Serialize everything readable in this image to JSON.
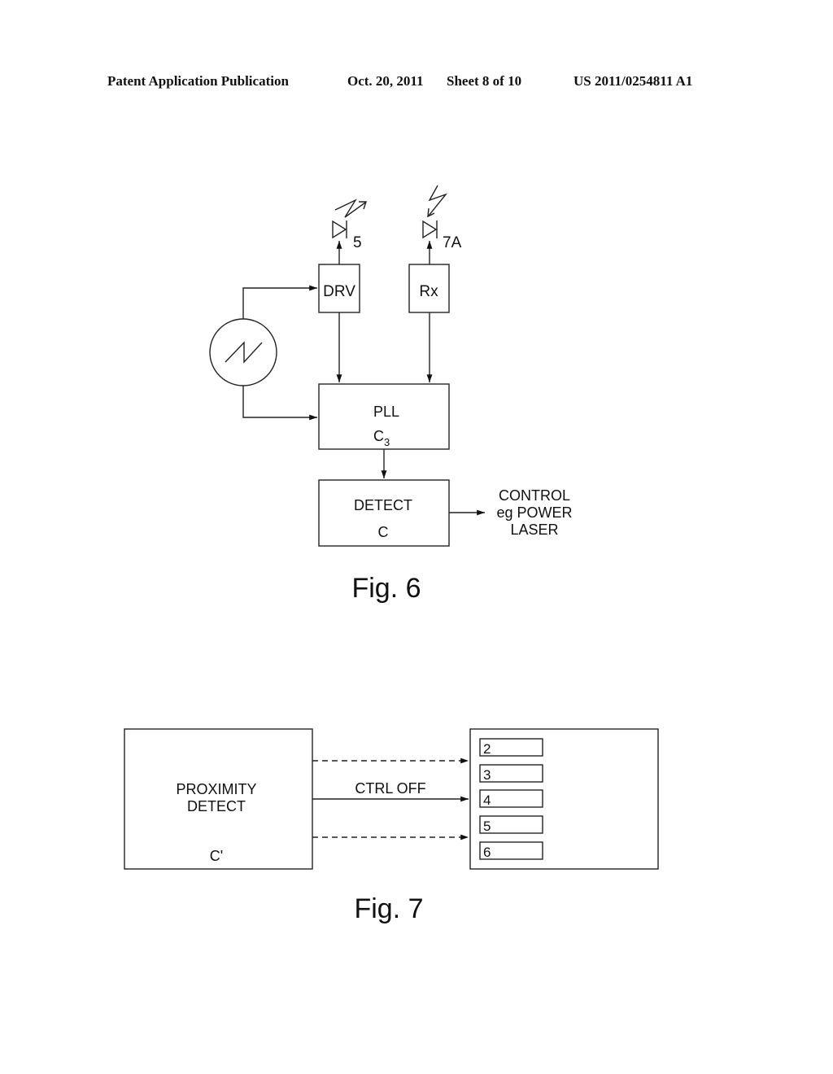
{
  "header": {
    "publication": "Patent Application Publication",
    "date": "Oct. 20, 2011",
    "sheet": "Sheet 8 of 10",
    "number": "US 2011/0254811 A1"
  },
  "fig6": {
    "caption": "Fig. 6",
    "emitter_ref": "5",
    "receiver_ref": "7A",
    "drv_label": "DRV",
    "rx_label": "Rx",
    "pll_label": "PLL",
    "pll_ref_main": "C",
    "pll_ref_sub": "3",
    "detect_label": "DETECT",
    "detect_ref": "C",
    "output_lines": [
      "CONTROL",
      "eg POWER",
      "LASER"
    ]
  },
  "fig7": {
    "caption": "Fig. 7",
    "source_lines": [
      "PROXIMITY",
      "DETECT"
    ],
    "source_ref": "C'",
    "signal_label": "CTRL OFF",
    "targets": [
      "2",
      "3",
      "4",
      "5",
      "6"
    ]
  }
}
